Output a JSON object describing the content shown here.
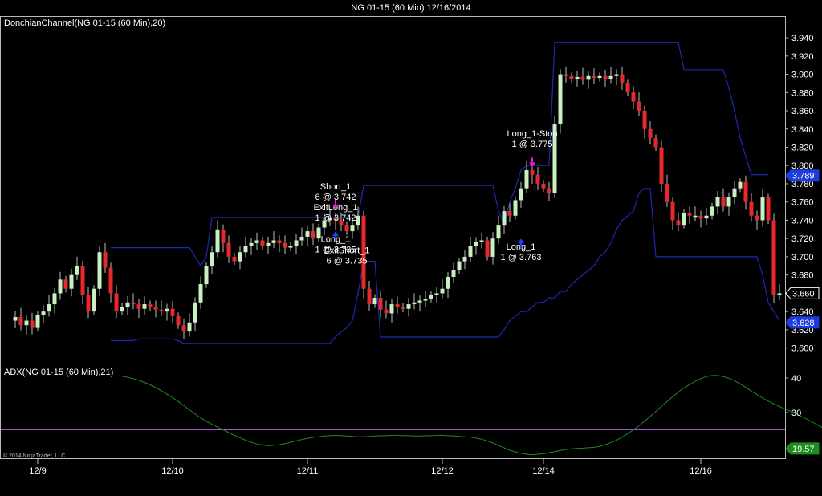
{
  "title": "NG 01-15 (60 Min)  12/16/2014",
  "copyright": "© 2014 NinjaTrader, LLC",
  "colors": {
    "background": "#000000",
    "up_candle": "#c8f0c0",
    "down_candle": "#e8282c",
    "channel": "#1e28b4",
    "adx_line": "#1e8c1e",
    "adx_threshold": "#a050c8",
    "marker": "#e020e0",
    "arrow_up": "#2040ff"
  },
  "chart_data": [
    {
      "type": "candlestick",
      "label": "DonchianChannel(NG 01-15 (60 Min),20)",
      "ylim": [
        3.59,
        3.955
      ],
      "yticks": [
        "3.940",
        "3.920",
        "3.900",
        "3.880",
        "3.860",
        "3.840",
        "3.820",
        "3.800",
        "3.780",
        "3.760",
        "3.740",
        "3.720",
        "3.700",
        "3.680",
        "3.660",
        "3.640",
        "3.620",
        "3.600"
      ],
      "x_labels": [
        "12/9",
        "12/10",
        "12/11",
        "12/12",
        "12/14",
        "12/16"
      ],
      "x_label_positions": [
        5,
        29,
        53,
        77,
        95,
        123
      ],
      "bar_count": 134,
      "close_path": [
        3.63,
        3.634,
        3.625,
        3.63,
        3.622,
        3.636,
        3.64,
        3.648,
        3.66,
        3.675,
        3.665,
        3.68,
        3.69,
        3.658,
        3.64,
        3.665,
        3.705,
        3.688,
        3.66,
        3.64,
        3.645,
        3.65,
        3.648,
        3.643,
        3.648,
        3.645,
        3.642,
        3.64,
        3.643,
        3.635,
        3.625,
        3.618,
        3.628,
        3.65,
        3.67,
        3.69,
        3.705,
        3.73,
        3.715,
        3.7,
        3.695,
        3.705,
        3.712,
        3.715,
        3.718,
        3.712,
        3.715,
        3.718,
        3.715,
        3.71,
        3.712,
        3.718,
        3.722,
        3.728,
        3.72,
        3.732,
        3.74,
        3.742,
        3.74,
        3.735,
        3.728,
        3.735,
        3.745,
        3.665,
        3.648,
        3.655,
        3.642,
        3.638,
        3.648,
        3.645,
        3.643,
        3.648,
        3.65,
        3.652,
        3.654,
        3.658,
        3.66,
        3.665,
        3.678,
        3.685,
        3.695,
        3.7,
        3.712,
        3.716,
        3.718,
        3.7,
        3.72,
        3.735,
        3.75,
        3.745,
        3.762,
        3.775,
        3.795,
        3.79,
        3.78,
        3.775,
        3.77,
        3.845,
        3.9,
        3.898,
        3.895,
        3.897,
        3.894,
        3.898,
        3.896,
        3.898,
        3.895,
        3.898,
        3.9,
        3.89,
        3.88,
        3.87,
        3.86,
        3.84,
        3.83,
        3.82,
        3.78,
        3.76,
        3.74,
        3.735,
        3.748,
        3.745,
        3.745,
        3.742,
        3.745,
        3.755,
        3.765,
        3.755,
        3.765,
        3.775,
        3.782,
        3.76,
        3.745,
        3.74,
        3.765,
        3.74,
        3.658,
        3.66
      ],
      "upper_channel": [
        null,
        null,
        null,
        null,
        null,
        null,
        null,
        null,
        null,
        null,
        null,
        null,
        null,
        null,
        null,
        null,
        null,
        null,
        3.71,
        3.71,
        3.71,
        3.71,
        3.71,
        3.71,
        3.71,
        3.71,
        3.71,
        3.71,
        3.71,
        3.71,
        3.71,
        3.71,
        3.71,
        3.7,
        3.69,
        3.7,
        3.743,
        3.743,
        3.743,
        3.743,
        3.743,
        3.743,
        3.743,
        3.743,
        3.743,
        3.743,
        3.743,
        3.743,
        3.743,
        3.743,
        3.743,
        3.743,
        3.743,
        3.743,
        3.743,
        3.743,
        3.743,
        3.743,
        3.743,
        3.743,
        3.743,
        3.743,
        3.743,
        3.778,
        3.778,
        3.778,
        3.778,
        3.778,
        3.778,
        3.778,
        3.778,
        3.778,
        3.778,
        3.778,
        3.778,
        3.778,
        3.778,
        3.778,
        3.778,
        3.778,
        3.778,
        3.778,
        3.778,
        3.778,
        3.778,
        3.778,
        3.778,
        3.75,
        3.735,
        3.76,
        3.775,
        3.795,
        3.8,
        3.8,
        3.8,
        3.8,
        3.8,
        3.935,
        3.935,
        3.935,
        3.935,
        3.935,
        3.935,
        3.935,
        3.935,
        3.935,
        3.935,
        3.935,
        3.935,
        3.935,
        3.935,
        3.935,
        3.935,
        3.935,
        3.935,
        3.935,
        3.935,
        3.935,
        3.935,
        3.935,
        3.905,
        3.905,
        3.905,
        3.905,
        3.905,
        3.905,
        3.905,
        3.905,
        3.885,
        3.86,
        3.83,
        3.81,
        3.79,
        3.79,
        3.79,
        3.79
      ],
      "lower_channel": [
        null,
        null,
        null,
        null,
        null,
        null,
        null,
        null,
        null,
        null,
        null,
        null,
        null,
        null,
        null,
        null,
        null,
        null,
        3.608,
        3.608,
        3.608,
        3.608,
        3.608,
        3.61,
        3.61,
        3.61,
        3.61,
        3.61,
        3.61,
        3.61,
        3.608,
        3.605,
        3.605,
        3.605,
        3.605,
        3.605,
        3.605,
        3.605,
        3.605,
        3.605,
        3.605,
        3.605,
        3.605,
        3.605,
        3.605,
        3.605,
        3.605,
        3.605,
        3.605,
        3.605,
        3.605,
        3.605,
        3.605,
        3.605,
        3.605,
        3.605,
        3.605,
        3.605,
        3.612,
        3.618,
        3.622,
        3.63,
        3.66,
        3.695,
        3.695,
        3.695,
        3.612,
        3.612,
        3.612,
        3.612,
        3.612,
        3.612,
        3.612,
        3.612,
        3.612,
        3.612,
        3.612,
        3.612,
        3.612,
        3.612,
        3.612,
        3.612,
        3.612,
        3.612,
        3.612,
        3.612,
        3.612,
        3.612,
        3.62,
        3.63,
        3.635,
        3.64,
        3.64,
        3.645,
        3.65,
        3.65,
        3.655,
        3.655,
        3.662,
        3.662,
        3.67,
        3.675,
        3.68,
        3.685,
        3.69,
        3.7,
        3.705,
        3.715,
        3.73,
        3.74,
        3.745,
        3.75,
        3.77,
        3.775,
        3.775,
        3.7,
        3.7,
        3.7,
        3.7,
        3.7,
        3.7,
        3.7,
        3.7,
        3.7,
        3.7,
        3.7,
        3.7,
        3.7,
        3.7,
        3.7,
        3.7,
        3.7,
        3.7,
        3.7,
        3.68,
        3.65,
        3.64,
        3.63
      ],
      "price_labels": [
        {
          "text": "3.789",
          "value": 3.789,
          "style": "blue"
        },
        {
          "text": "3.660",
          "value": 3.66,
          "style": "outline"
        },
        {
          "text": "3.628",
          "value": 3.628,
          "style": "blue"
        }
      ],
      "annotations": [
        {
          "lines": [
            "Short_1",
            "6 @ 3.742",
            "ExitLong_1",
            "1 @ 3.742"
          ],
          "bar": 58,
          "anchor_value": 3.774,
          "marker": "down",
          "marker_value": 3.752
        },
        {
          "lines": [
            "Long_1",
            "1 @ 3.735"
          ],
          "bar": 58,
          "anchor_value": 3.716,
          "marker": "up",
          "marker_value": 3.728
        },
        {
          "lines": [
            "ExitShort_1",
            "6 @ 3.735"
          ],
          "bar": 60,
          "anchor_value": 3.704,
          "marker": "none",
          "marker_value": null
        },
        {
          "lines": [
            "Long_1-Stop",
            "1 @ 3.775"
          ],
          "bar": 93,
          "anchor_value": 3.832,
          "marker": "down",
          "marker_value": 3.798
        },
        {
          "lines": [
            "Long_1",
            "1 @ 3.763"
          ],
          "bar": 91,
          "anchor_value": 3.708,
          "marker": "up",
          "marker_value": 3.72
        }
      ]
    },
    {
      "type": "line",
      "label": "ADX(NG 01-15 (60 Min),21)",
      "ylim": [
        17,
        43
      ],
      "yticks": [
        "40",
        "30"
      ],
      "threshold": 25,
      "last_value_label": "19.57",
      "last_value": 19.57,
      "values": [
        40.5,
        40.2,
        39.8,
        39.3,
        38.7,
        38.0,
        37.2,
        36.3,
        35.3,
        34.3,
        33.2,
        32.0,
        30.8,
        29.6,
        28.5,
        27.5,
        26.6,
        25.8,
        25.0,
        24.2,
        23.4,
        22.7,
        22.0,
        21.4,
        20.9,
        20.6,
        20.4,
        20.5,
        20.7,
        21.0,
        21.4,
        21.8,
        22.2,
        22.5,
        22.8,
        23.0,
        23.2,
        23.3,
        23.4,
        23.3,
        23.2,
        23.1,
        23.0,
        23.0,
        23.1,
        23.2,
        23.3,
        23.3,
        23.4,
        23.4,
        23.3,
        23.3,
        23.2,
        23.2,
        23.3,
        23.3,
        23.4,
        23.4,
        23.3,
        23.2,
        23.1,
        23.0,
        22.9,
        22.6,
        22.3,
        21.8,
        21.2,
        20.5,
        19.8,
        19.1,
        18.6,
        18.2,
        17.9,
        17.8,
        17.9,
        18.1,
        18.4,
        18.7,
        19.0,
        19.3,
        19.5,
        19.6,
        19.7,
        19.8,
        19.9,
        20.2,
        20.7,
        21.3,
        22.0,
        22.9,
        23.9,
        25.0,
        26.2,
        27.5,
        28.9,
        30.3,
        31.8,
        33.2,
        34.6,
        35.9,
        37.1,
        38.1,
        39.0,
        39.8,
        40.4,
        40.7,
        40.7,
        40.4,
        39.9,
        39.2,
        38.3,
        37.3,
        36.2,
        35.2,
        34.2,
        33.3,
        32.5,
        31.7,
        31.0,
        30.3,
        29.6,
        28.8,
        28.0,
        27.1,
        26.2,
        25.3,
        24.4,
        23.5,
        22.6,
        21.9,
        21.2,
        20.6,
        20.2,
        19.9,
        19.6,
        19.4,
        19.5,
        19.8,
        20.1,
        20.3
      ]
    }
  ]
}
